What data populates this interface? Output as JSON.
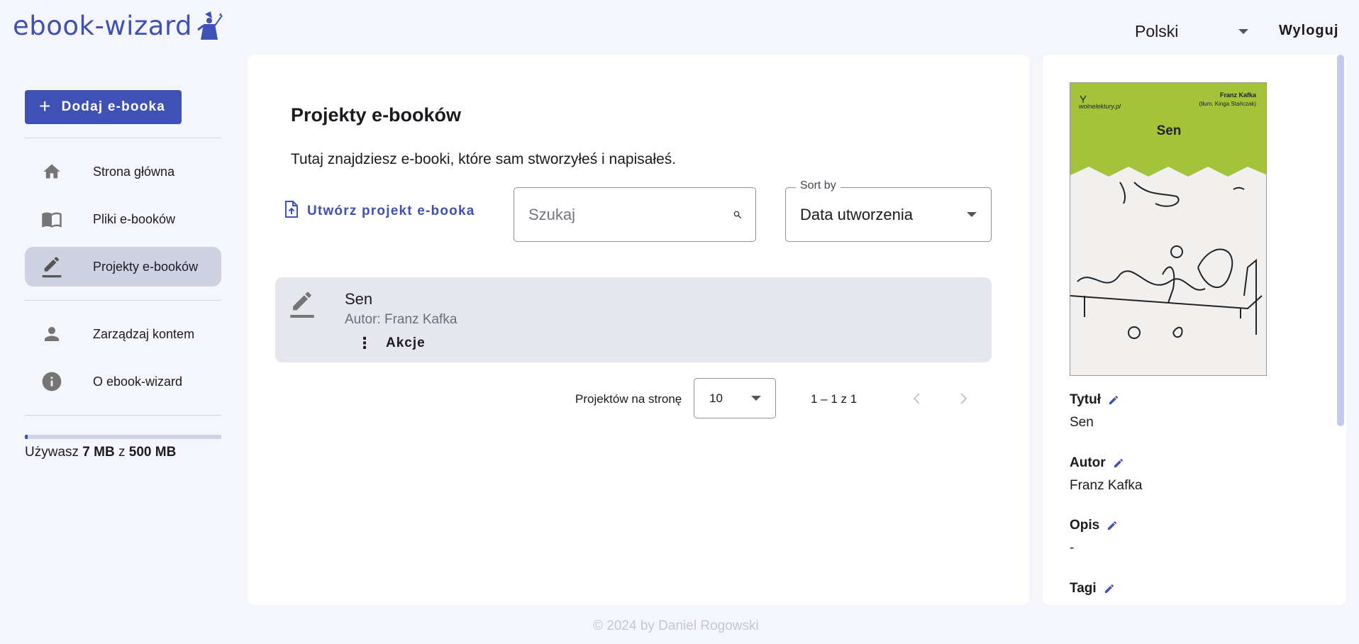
{
  "app": {
    "logo_text": "ebook-wizard"
  },
  "header": {
    "language": "Polski",
    "logout": "Wyloguj"
  },
  "sidebar": {
    "add_button": "Dodaj e-booka",
    "items": [
      {
        "label": "Strona główna",
        "icon": "home-icon"
      },
      {
        "label": "Pliki e-booków",
        "icon": "book-icon"
      },
      {
        "label": "Projekty e-booków",
        "icon": "edit-icon",
        "active": true
      },
      {
        "label": "Zarządzaj kontem",
        "icon": "person-icon"
      },
      {
        "label": "O ebook-wizard",
        "icon": "info-icon"
      }
    ],
    "storage": {
      "prefix": "Używasz ",
      "used": "7 MB",
      "middle": " z ",
      "total": "500 MB",
      "fraction": 0.014
    }
  },
  "main": {
    "title": "Projekty e-booków",
    "description": "Tutaj znajdziesz e-booki, które sam stworzyłeś i napisałeś.",
    "create_link": "Utwórz projekt e-booka",
    "search_placeholder": "Szukaj",
    "sort": {
      "legend": "Sort by",
      "value": "Data utworzenia"
    },
    "projects": [
      {
        "title": "Sen",
        "author": "Autor: Franz Kafka",
        "actions": "Akcje"
      }
    ],
    "pagination": {
      "per_page_label": "Projektów na stronę",
      "per_page": "10",
      "range": "1 – 1 z 1"
    }
  },
  "details": {
    "cover": {
      "publisher": "wolnelektury.pl",
      "author": "Franz Kafka",
      "translator": "(tłum. Kinga Stańczak)",
      "title": "Sen",
      "accent": "#a4c33a"
    },
    "fields": [
      {
        "label": "Tytuł",
        "value": "Sen"
      },
      {
        "label": "Autor",
        "value": "Franz Kafka"
      },
      {
        "label": "Opis",
        "value": "-"
      },
      {
        "label": "Tagi",
        "value": ""
      }
    ]
  },
  "footer": {
    "text": "© 2024 by Daniel Rogowski"
  },
  "colors": {
    "primary": "#3f51b5",
    "background": "#f5f6fc",
    "active_nav": "#cfd2e2",
    "card": "#e6e6ef"
  }
}
